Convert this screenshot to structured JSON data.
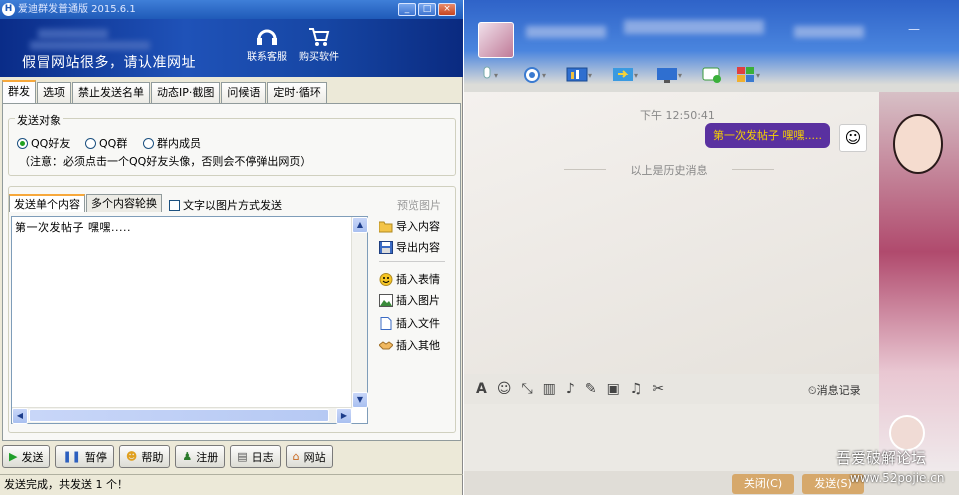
{
  "left_app": {
    "title": "爱迪群发普通版 2015.6.1",
    "title_logo": "H",
    "window_buttons": [
      "minimize",
      "maximize",
      "close"
    ],
    "banner": {
      "warning": "假冒网站很多，请认准网址",
      "contact_label": "联系客服",
      "buy_label": "购买软件"
    },
    "tabs": [
      "群发",
      "选项",
      "禁止发送名单",
      "动态IP·截图",
      "问候语",
      "定时·循环"
    ],
    "target_group": {
      "legend": "发送对象",
      "options": [
        "QQ好友",
        "QQ群",
        "群内成员"
      ],
      "selected": "QQ好友",
      "note": "（注意：必须点击一个QQ好友头像，否则会不停弹出网页）"
    },
    "sub_tabs": [
      "发送单个内容",
      "多个内容轮换"
    ],
    "image_mode_checkbox": "文字以图片方式发送",
    "preview_label": "预览图片",
    "message_text": "第一次发帖子 嘿嘿.....",
    "side_actions": {
      "import": "导入内容",
      "export": "导出内容",
      "emoji": "插入表情",
      "image": "插入图片",
      "file": "插入文件",
      "other": "插入其他"
    },
    "bottom_buttons": {
      "send": "发送",
      "pause": "暂停",
      "help": "帮助",
      "register": "注册",
      "log": "日志",
      "website": "网站"
    },
    "status": "发送完成，共发送 1 个！"
  },
  "chat": {
    "time": "下午 12:50:41",
    "bubble": "第一次发帖子 嘿嘿.....",
    "history_label": "以上是历史消息",
    "message_record": "消息记录",
    "close_button": "关闭(C)",
    "send_button": "发送(S)",
    "watermark_title": "吾爱破解论坛",
    "watermark_url": "www.52pojie.cn",
    "bubble_color": "#5a31a0"
  }
}
